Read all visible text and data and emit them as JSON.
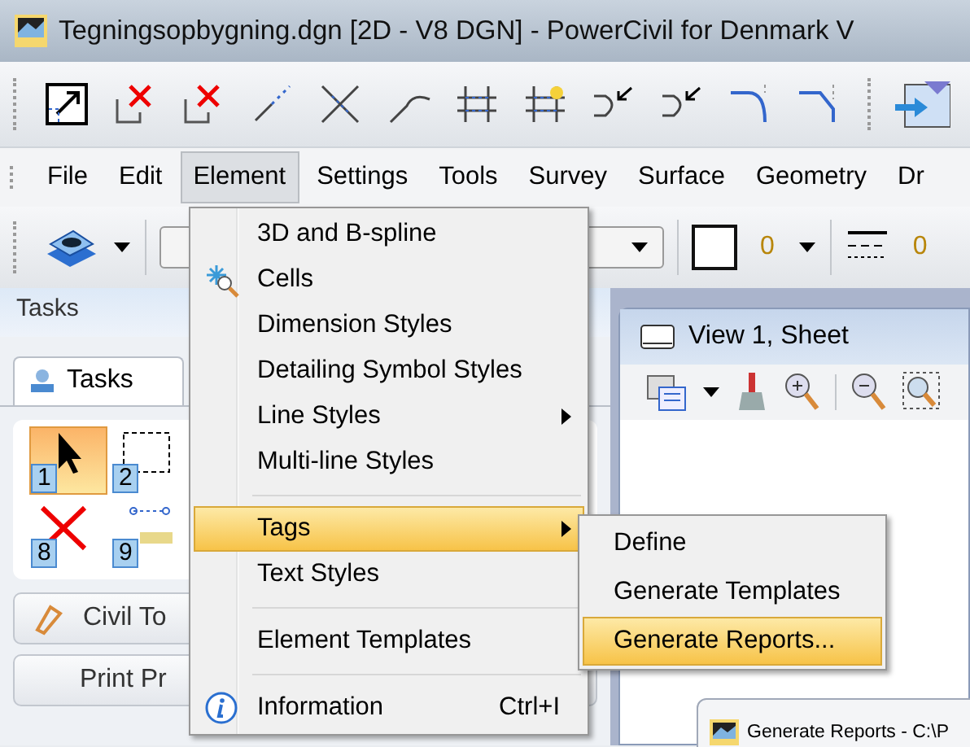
{
  "window": {
    "title": "Tegningsopbygning.dgn [2D - V8 DGN] - PowerCivil for Denmark V"
  },
  "menu_bar": [
    {
      "label": "File",
      "selected": false
    },
    {
      "label": "Edit",
      "selected": false
    },
    {
      "label": "Element",
      "selected": true
    },
    {
      "label": "Settings",
      "selected": false
    },
    {
      "label": "Tools",
      "selected": false
    },
    {
      "label": "Survey",
      "selected": false
    },
    {
      "label": "Surface",
      "selected": false
    },
    {
      "label": "Geometry",
      "selected": false
    },
    {
      "label": "Dr",
      "selected": false
    }
  ],
  "toolbar": {
    "color_value": "0",
    "style_value": "0"
  },
  "tasks_panel": {
    "title": "Tasks",
    "tab": "Tasks",
    "tools": [
      {
        "number": "1",
        "kind": "select",
        "selected": true
      },
      {
        "number": "2",
        "kind": "fence",
        "selected": false
      },
      {
        "number": "8",
        "kind": "delete",
        "selected": false
      },
      {
        "number": "9",
        "kind": "measure",
        "selected": false
      }
    ],
    "buttons": [
      "Civil To",
      "Print Pr"
    ]
  },
  "view": {
    "title": "View 1, Sheet"
  },
  "element_menu": [
    {
      "kind": "item",
      "label": "3D and B-spline",
      "selected": false,
      "submenu": false
    },
    {
      "kind": "item",
      "label": "Cells",
      "selected": false,
      "submenu": false
    },
    {
      "kind": "item",
      "label": "Dimension Styles",
      "selected": false,
      "submenu": false
    },
    {
      "kind": "item",
      "label": "Detailing Symbol Styles",
      "selected": false,
      "submenu": false
    },
    {
      "kind": "item",
      "label": "Line Styles",
      "selected": false,
      "submenu": true
    },
    {
      "kind": "item",
      "label": "Multi-line Styles",
      "selected": false,
      "submenu": false
    },
    {
      "kind": "separator"
    },
    {
      "kind": "item",
      "label": "Tags",
      "selected": true,
      "submenu": true
    },
    {
      "kind": "item",
      "label": "Text Styles",
      "selected": false,
      "submenu": false
    },
    {
      "kind": "separator"
    },
    {
      "kind": "item",
      "label": "Element Templates",
      "selected": false,
      "submenu": false
    },
    {
      "kind": "separator"
    },
    {
      "kind": "item",
      "label": "Information",
      "selected": false,
      "submenu": false,
      "shortcut": "Ctrl+I"
    }
  ],
  "tags_submenu": [
    {
      "label": "Define",
      "selected": false
    },
    {
      "label": "Generate Templates",
      "selected": false
    },
    {
      "label": "Generate Reports...",
      "selected": true
    }
  ],
  "dialog_tab": {
    "title": "Generate Reports - C:\\P"
  }
}
